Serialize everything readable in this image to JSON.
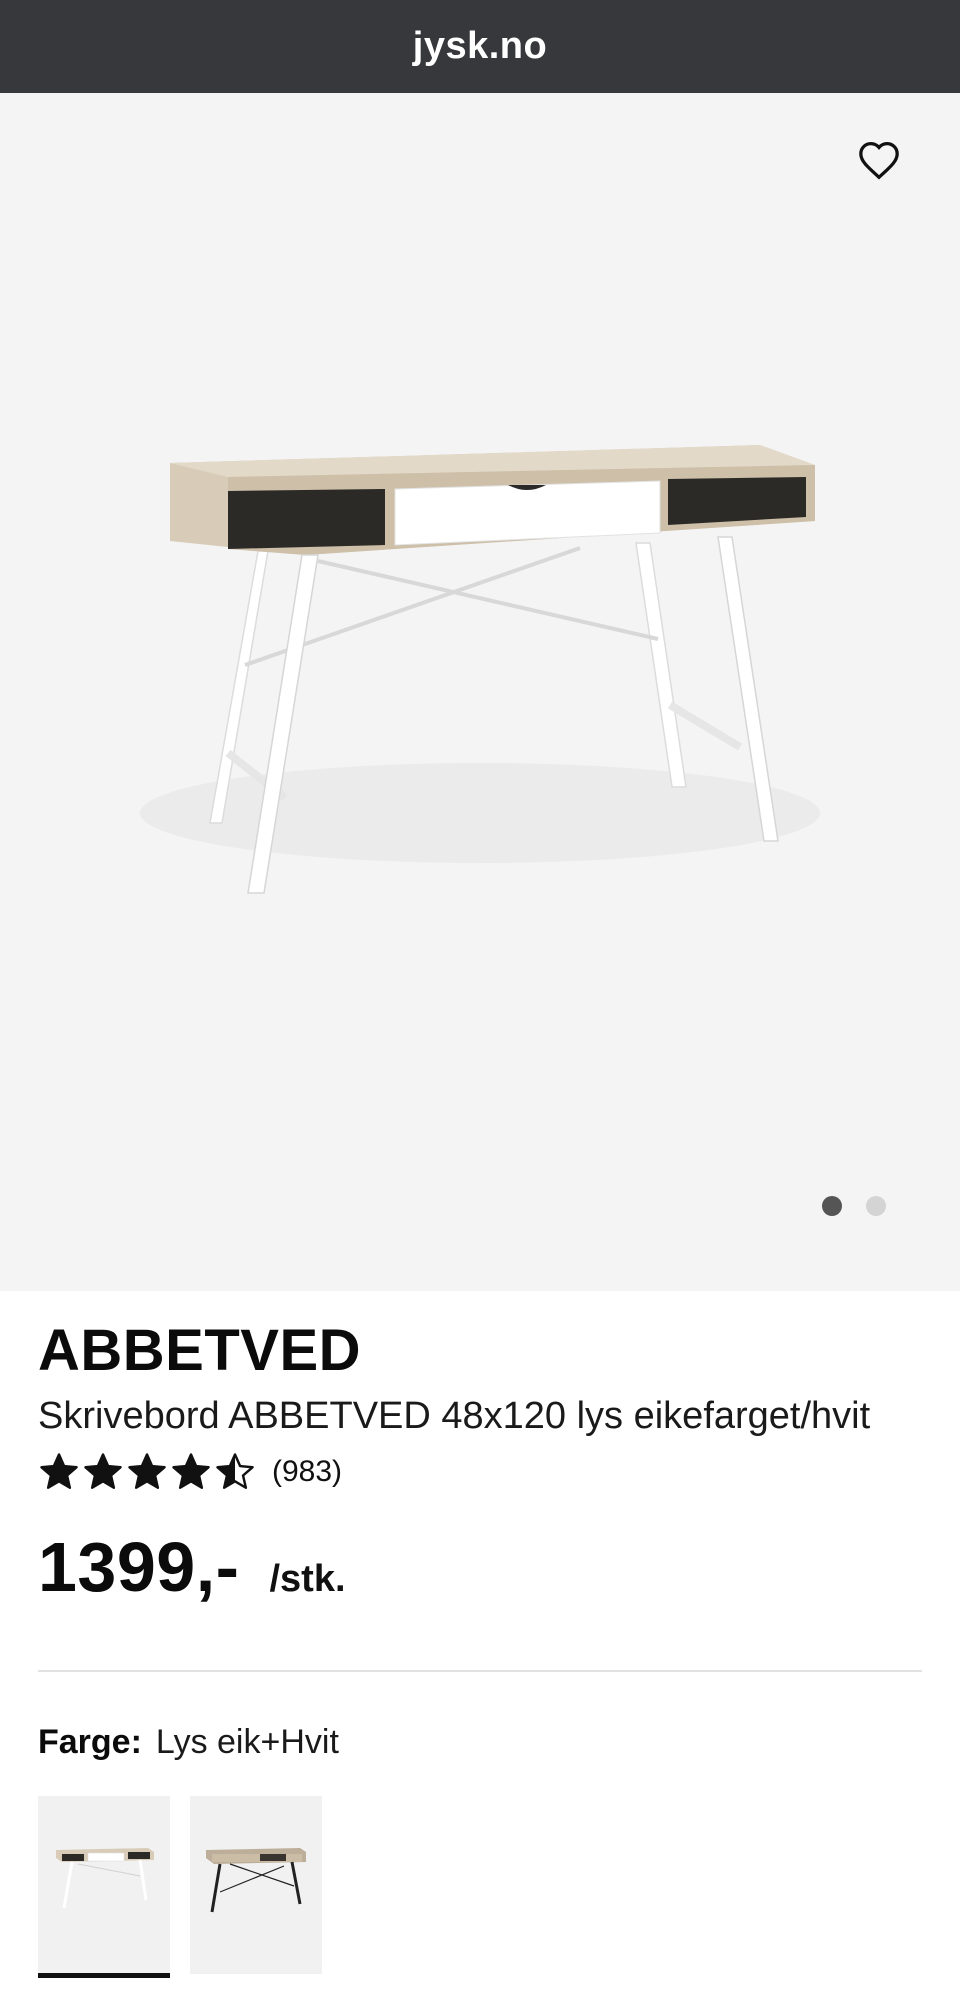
{
  "browser": {
    "domain": "jysk.no"
  },
  "gallery": {
    "image_count": 2,
    "active_index": 0
  },
  "product": {
    "name": "ABBETVED",
    "description": "Skrivebord ABBETVED 48x120 lys eikefarget/hvit",
    "rating": {
      "value": 4.5,
      "max": 5,
      "count_text": "(983)"
    },
    "price": "1399,-",
    "price_unit": "/stk."
  },
  "color": {
    "label": "Farge:",
    "value": "Lys eik+Hvit",
    "options": [
      {
        "name": "light-oak-white",
        "selected": true
      },
      {
        "name": "light-oak-black",
        "selected": false
      }
    ]
  },
  "colors": {
    "topbar": "#37383b",
    "gallery_bg": "#f4f4f4",
    "oak": "#d7cbb7",
    "text": "#111111"
  }
}
